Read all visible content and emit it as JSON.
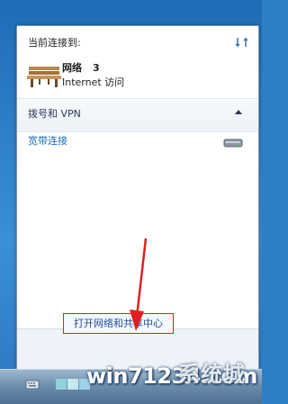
{
  "panel": {
    "current_connection_label": "当前连接到:",
    "network_name": "网络",
    "network_number": "3",
    "network_access": "Internet 访问",
    "dialup_section_label": "拨号和 VPN",
    "broadband_label": "宽带连接",
    "open_center_link": "打开网络和共享中心"
  },
  "watermark": {
    "text": "win71234.com",
    "suffix": "系统城"
  },
  "colors": {
    "link": "#1a4e9b",
    "broadband": "#1a6fb7",
    "highlight_box": "#e02020",
    "arrow": "#e02020"
  },
  "icons": [
    "refresh-icon",
    "network-bench-icon",
    "collapse-chevron-icon",
    "modem-icon",
    "keyboard-icon",
    "flag-icon"
  ]
}
